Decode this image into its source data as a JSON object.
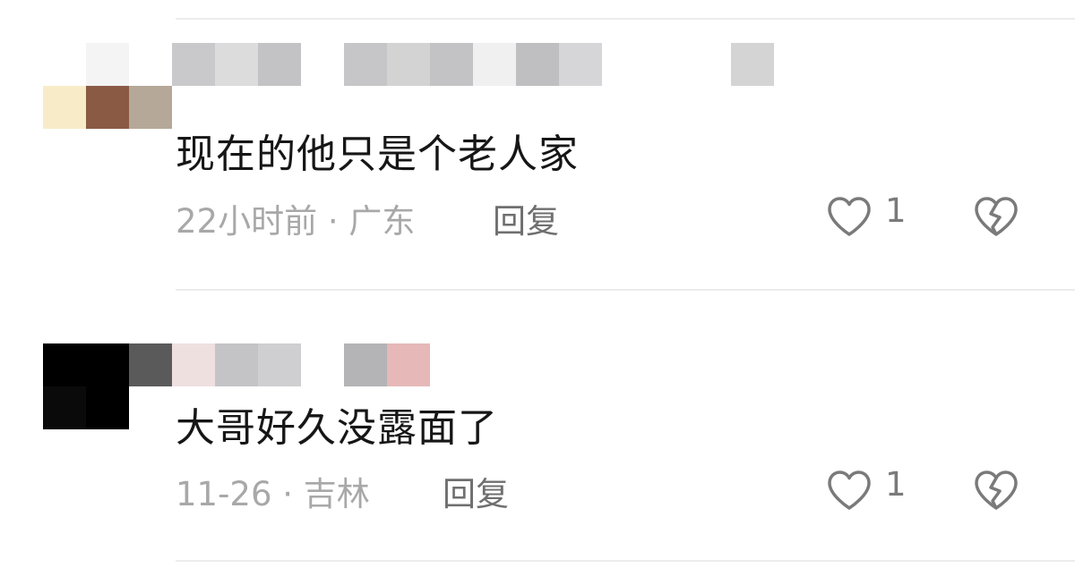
{
  "comments": [
    {
      "text": "现在的他只是个老人家",
      "time_location": "22小时前 · 广东",
      "reply_label": "回复",
      "like_count": "1",
      "like_icon": "heart-outline-icon",
      "dislike_icon": "broken-heart-icon"
    },
    {
      "text": "大哥好久没露面了",
      "time_location": "11-26 · 吉林",
      "reply_label": "回复",
      "like_count": "1",
      "like_icon": "heart-outline-icon",
      "dislike_icon": "broken-heart-icon"
    }
  ],
  "colors": {
    "text_primary": "#161616",
    "text_meta": "#a8a8a8",
    "reply": "#6f6f6f",
    "icon": "#7a7a7a",
    "divider": "#ececec"
  }
}
